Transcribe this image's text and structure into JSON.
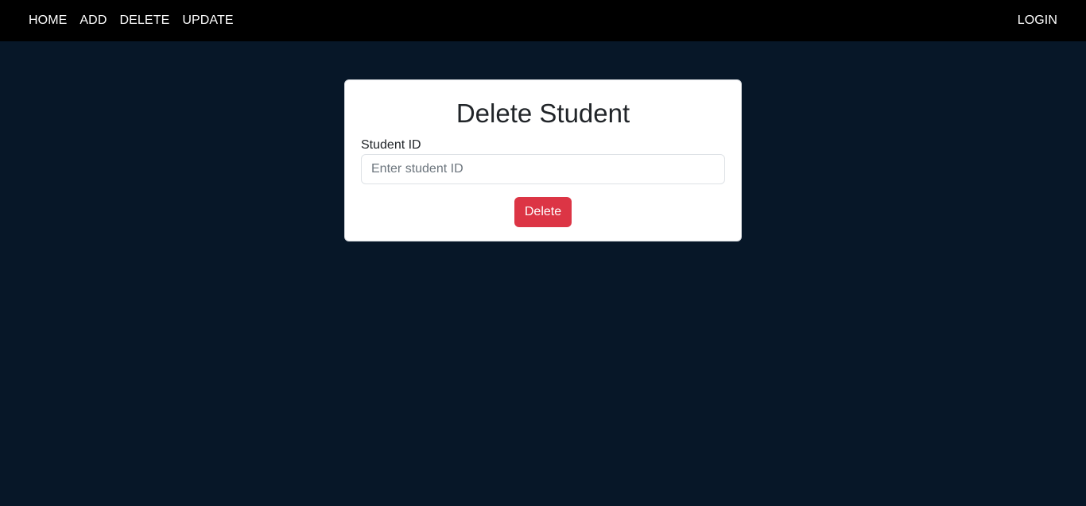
{
  "navbar": {
    "links": [
      "HOME",
      "ADD",
      "DELETE",
      "UPDATE"
    ],
    "login_label": "LOGIN"
  },
  "form": {
    "title": "Delete Student",
    "student_id_label": "Student ID",
    "student_id_value": "",
    "student_id_placeholder": "Enter student ID",
    "submit_label": "Delete"
  },
  "colors": {
    "background": "#071728",
    "navbar": "#000000",
    "card": "#ffffff",
    "danger_button": "#dc3545"
  }
}
